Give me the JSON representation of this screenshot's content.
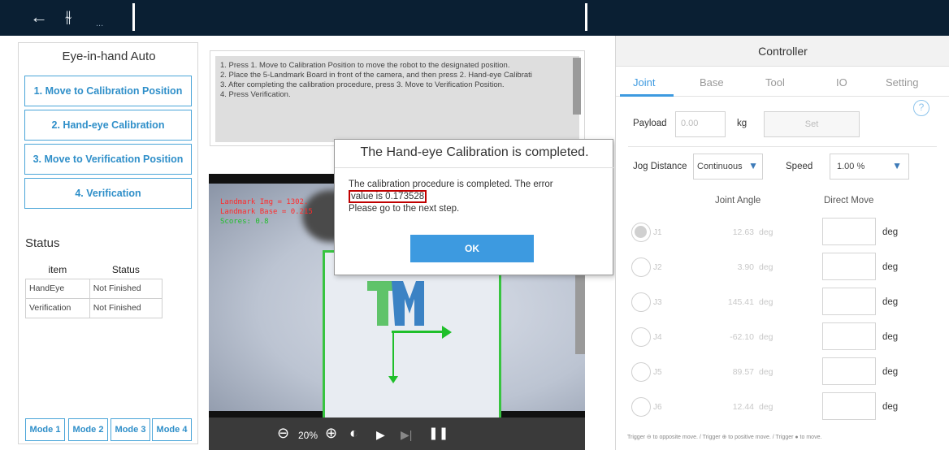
{
  "topbar": {
    "back_icon": "←",
    "settings_icon": "⫳",
    "more_icon": "..."
  },
  "left_panel": {
    "title": "Eye-in-hand Auto",
    "steps": [
      "1. Move to Calibration Position",
      "2. Hand-eye Calibration",
      "3. Move to Verification Position",
      "4. Verification"
    ],
    "status_title": "Status",
    "table_headers": [
      "item",
      "Status"
    ],
    "rows": [
      {
        "item": "HandEye",
        "status": "Not Finished"
      },
      {
        "item": "Verification",
        "status": "Not Finished"
      }
    ],
    "modes": [
      "Mode 1",
      "Mode 2",
      "Mode 3",
      "Mode 4"
    ]
  },
  "instructions": {
    "lines": [
      "1. Press 1. Move to Calibration Position to move the robot to the designated position.",
      "2. Place the 5-Landmark Board in front of the camera, and then press 2. Hand-eye Calibrati",
      "3. After completing the calibration procedure, press 3. Move to Verification Position.",
      "4. Press Verification."
    ]
  },
  "camera": {
    "overlay_line1": "Landmark Img   = 1302.",
    "overlay_line2": "Landmark Base  = 0.215",
    "overlay_line3": "Scores: 0.8",
    "zoom": "20%",
    "colors": {
      "overlay_red": "#ff2b2b",
      "overlay_green": "#1fbf2a"
    }
  },
  "dialog": {
    "title": "The Hand-eye Calibration is completed.",
    "body_line1": "The calibration procedure is completed. The error",
    "body_highlight": "value is 0.173528",
    "body_line3": "Please go to the next step.",
    "ok_label": "OK"
  },
  "controller": {
    "title": "Controller",
    "tabs": [
      "Joint",
      "Base",
      "Tool",
      "IO",
      "Setting"
    ],
    "active_tab": "Joint",
    "help_icon": "?",
    "payload_label": "Payload",
    "payload_placeholder": "0.00",
    "payload_unit": "kg",
    "set_label": "Set",
    "jog_label": "Jog Distance",
    "jog_value": "Continuous",
    "speed_label": "Speed",
    "speed_value": "1.00 %",
    "joint_angle_header": "Joint Angle",
    "direct_move_header": "Direct Move",
    "joints": [
      {
        "name": "J1",
        "value": "12.63",
        "unit": "deg",
        "move_unit": "deg"
      },
      {
        "name": "J2",
        "value": "3.90",
        "unit": "deg",
        "move_unit": "deg"
      },
      {
        "name": "J3",
        "value": "145.41",
        "unit": "deg",
        "move_unit": "deg"
      },
      {
        "name": "J4",
        "value": "-62.10",
        "unit": "deg",
        "move_unit": "deg"
      },
      {
        "name": "J5",
        "value": "89.57",
        "unit": "deg",
        "move_unit": "deg"
      },
      {
        "name": "J6",
        "value": "12.44",
        "unit": "deg",
        "move_unit": "deg"
      }
    ],
    "footer": "Trigger ⊖ to opposite move.  /  Trigger ⊕ to positive move.  /  Trigger ● to move.",
    "accent_color": "#3d9ae0"
  }
}
